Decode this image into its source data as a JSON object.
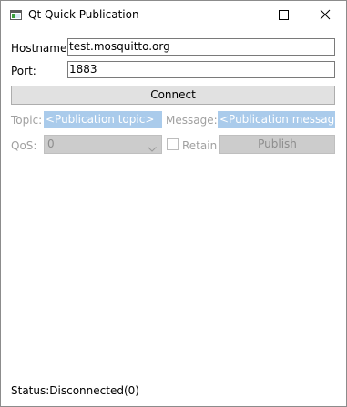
{
  "window": {
    "title": "Qt Quick Publication",
    "icon": "qt-window-icon",
    "controls": [
      "minimize-icon",
      "maximize-icon",
      "close-icon"
    ]
  },
  "connection": {
    "hostname_label": "Hostname:",
    "hostname_value": "test.mosquitto.org",
    "port_label": "Port:",
    "port_value": "1883",
    "connect_label": "Connect"
  },
  "publish": {
    "topic_label": "Topic:",
    "topic_placeholder": "<Publication topic>",
    "message_label": "Message:",
    "message_placeholder": "<Publication message>",
    "qos_label": "QoS:",
    "qos_value": "0",
    "retain_label": "Retain",
    "retain_checked": false,
    "publish_label": "Publish"
  },
  "status": {
    "text": "Status:Disconnected(0)"
  },
  "colors": {
    "placeholder_bg": "#aacbeb",
    "disabled_button_bg": "#cccccc",
    "button_bg": "#e1e1e1",
    "disabled_text": "#a0a0a0"
  }
}
